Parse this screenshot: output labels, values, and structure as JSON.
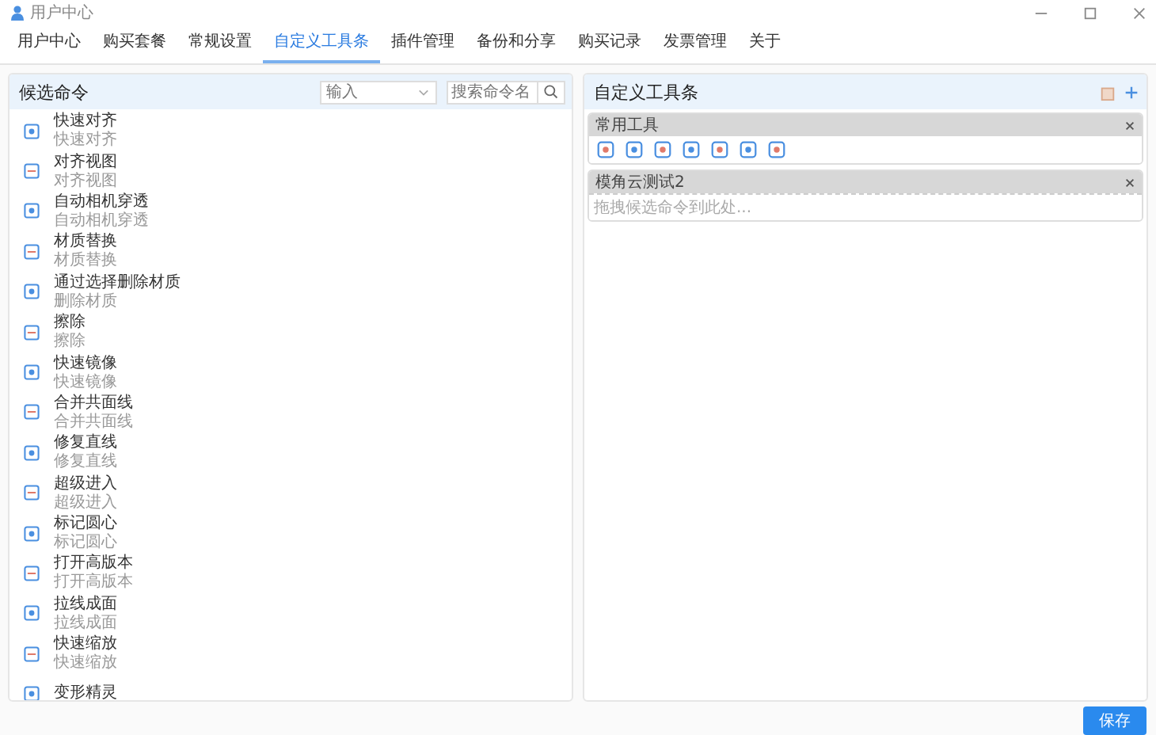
{
  "window": {
    "title": "用户中心"
  },
  "tabs": [
    {
      "label": "用户中心",
      "selected": false
    },
    {
      "label": "购买套餐",
      "selected": false
    },
    {
      "label": "常规设置",
      "selected": false
    },
    {
      "label": "自定义工具条",
      "selected": true
    },
    {
      "label": "插件管理",
      "selected": false
    },
    {
      "label": "备份和分享",
      "selected": false
    },
    {
      "label": "购买记录",
      "selected": false
    },
    {
      "label": "发票管理",
      "selected": false
    },
    {
      "label": "关于",
      "selected": false
    }
  ],
  "candidates": {
    "title": "候选命令",
    "filter": {
      "placeholder": "输入"
    },
    "search": {
      "placeholder": "搜索命令名"
    },
    "items": [
      {
        "title": "快速对齐",
        "subtitle": "快速对齐"
      },
      {
        "title": "对齐视图",
        "subtitle": "对齐视图"
      },
      {
        "title": "自动相机穿透",
        "subtitle": "自动相机穿透"
      },
      {
        "title": "材质替换",
        "subtitle": "材质替换"
      },
      {
        "title": "通过选择删除材质",
        "subtitle": "删除材质"
      },
      {
        "title": "擦除",
        "subtitle": "擦除"
      },
      {
        "title": "快速镜像",
        "subtitle": "快速镜像"
      },
      {
        "title": "合并共面线",
        "subtitle": "合并共面线"
      },
      {
        "title": "修复直线",
        "subtitle": "修复直线"
      },
      {
        "title": "超级进入",
        "subtitle": "超级进入"
      },
      {
        "title": "标记圆心",
        "subtitle": "标记圆心"
      },
      {
        "title": "打开高版本",
        "subtitle": "打开高版本"
      },
      {
        "title": "拉线成面",
        "subtitle": "拉线成面"
      },
      {
        "title": "快速缩放",
        "subtitle": "快速缩放"
      },
      {
        "title": "变形精灵"
      }
    ]
  },
  "toolbars": {
    "title": "自定义工具条",
    "groups": [
      {
        "name": "常用工具",
        "kind": "tools"
      },
      {
        "name": "模角云测试2",
        "kind": "empty",
        "hint": "拖拽候选命令到此处..."
      }
    ]
  },
  "save_button": "保存"
}
